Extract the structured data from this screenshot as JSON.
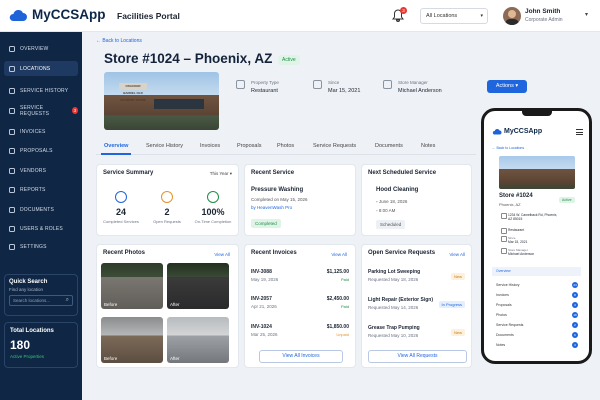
{
  "app": {
    "name": "MyCCSApp",
    "portal": "Facilities Portal"
  },
  "header": {
    "notif_count": "3",
    "location_select": "All Locations",
    "user_name": "John Smith",
    "user_role": "Corporate Admin"
  },
  "nav": [
    {
      "label": "Overview"
    },
    {
      "label": "Locations"
    },
    {
      "label": "Service History"
    },
    {
      "label": "Service Requests",
      "badge": "3"
    },
    {
      "label": "Invoices"
    },
    {
      "label": "Proposals"
    },
    {
      "label": "Vendors"
    },
    {
      "label": "Reports"
    },
    {
      "label": "Documents"
    },
    {
      "label": "Users & Roles"
    },
    {
      "label": "Settings"
    }
  ],
  "quick_search": {
    "title": "Quick Search",
    "subtitle": "Find any location",
    "placeholder": "Search locations..."
  },
  "total_locations": {
    "title": "Total Locations",
    "value": "180",
    "sub": "Active Properties"
  },
  "page": {
    "back": "← Back to Locations",
    "title": "Store #1024 – Phoenix, AZ",
    "status": "Active",
    "store_sign": "CRACKER BARREL OLD COUNTRY STORE",
    "property_type_label": "Property Type",
    "property_type": "Restaurant",
    "since_label": "Since",
    "since": "Mar 15, 2021",
    "manager_label": "Store Manager",
    "manager": "Michael Anderson",
    "actions": "Actions"
  },
  "tabs": [
    "Overview",
    "Service History",
    "Invoices",
    "Proposals",
    "Photos",
    "Service Requests",
    "Documents",
    "Notes"
  ],
  "summary": {
    "title": "Service Summary",
    "period": "This Year",
    "stats": [
      {
        "value": "24",
        "label": "Completed Services"
      },
      {
        "value": "2",
        "label": "Open Requests"
      },
      {
        "value": "100%",
        "label": "On-Time Completion"
      }
    ]
  },
  "recent_service": {
    "title": "Recent Service",
    "name": "Pressure Washing",
    "completed": "Completed on May 15, 2026",
    "vendor": "by HeavenWash Pro",
    "status": "Completed"
  },
  "next_service": {
    "title": "Next Scheduled Service",
    "name": "Hood Cleaning",
    "date": "June 18, 2026",
    "time": "8:00 AM",
    "status": "Scheduled"
  },
  "photos": {
    "title": "Recent Photos",
    "view_all": "View All",
    "labels": [
      "Before",
      "After",
      "Before",
      "After"
    ]
  },
  "invoices": {
    "title": "Recent Invoices",
    "view_all": "View All",
    "items": [
      {
        "id": "INV-3088",
        "date": "May 19, 2026",
        "amount": "$1,125.00",
        "status": "Paid"
      },
      {
        "id": "INV-2057",
        "date": "Apr 21, 2026",
        "amount": "$2,450.00",
        "status": "Paid"
      },
      {
        "id": "INV-1024",
        "date": "Mar 25, 2026",
        "amount": "$1,850.00",
        "status": "Unpaid"
      }
    ],
    "button": "View All Invoices"
  },
  "requests": {
    "title": "Open Service Requests",
    "view_all": "View All",
    "items": [
      {
        "name": "Parking Lot Sweeping",
        "date": "Requested May 18, 2026",
        "status": "New"
      },
      {
        "name": "Light Repair (Exterior Sign)",
        "date": "Requested May 14, 2026",
        "status": "In Progress"
      },
      {
        "name": "Grease Trap Pumping",
        "date": "Requested May 10, 2026",
        "status": "New"
      }
    ],
    "button": "View All Requests"
  },
  "phone": {
    "app": "MyCCSApp",
    "back": "← Back to Locations",
    "title": "Store #1024",
    "city": "Phoenix, AZ",
    "status": "Active",
    "meta": [
      {
        "label": "",
        "value": "1234 W. Camelback Rd, Phoenix, AZ 85015"
      },
      {
        "label": "",
        "value": "Restaurant"
      },
      {
        "label": "Since",
        "value": "Mar 15, 2021"
      },
      {
        "label": "Store Manager",
        "value": "Michael Anderson"
      }
    ],
    "overview": "Overview",
    "items": [
      {
        "label": "Service History",
        "count": "24"
      },
      {
        "label": "Invoices",
        "count": "8"
      },
      {
        "label": "Proposals",
        "count": "3"
      },
      {
        "label": "Photos",
        "count": "18"
      },
      {
        "label": "Service Requests",
        "count": "2"
      },
      {
        "label": "Documents",
        "count": "6"
      },
      {
        "label": "Notes",
        "count": "3"
      }
    ]
  },
  "colors": {
    "navy": "#0f2645",
    "blue": "#1f66de",
    "green": "#1e8e49",
    "red": "#e53935",
    "orange": "#e6932a"
  }
}
